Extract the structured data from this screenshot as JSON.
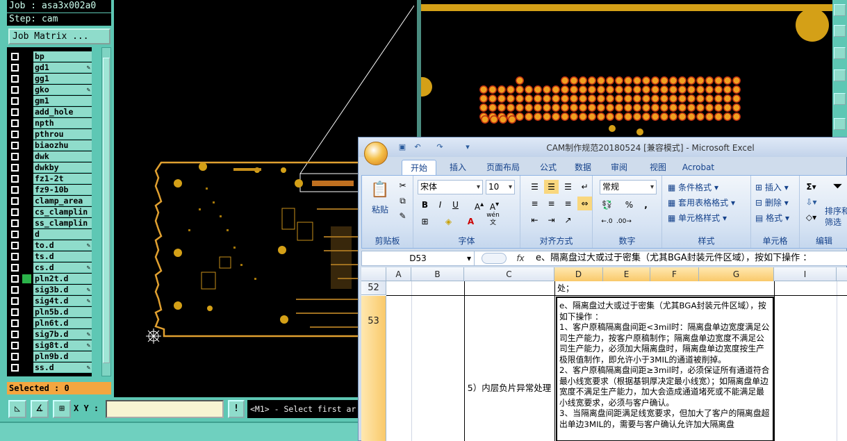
{
  "cam": {
    "job": "Job : asa3x002a0",
    "step": "Step: cam",
    "job_matrix": "Job Matrix ...",
    "selected": "Selected : 0",
    "xy_label": "X Y :",
    "xy_value": "",
    "message": "<M1> - Select first ar",
    "layers": [
      {
        "name": "bp",
        "active": false,
        "edit": false
      },
      {
        "name": "gd1",
        "active": false,
        "edit": true
      },
      {
        "name": "gg1",
        "active": false,
        "edit": false
      },
      {
        "name": "gko",
        "active": false,
        "edit": true
      },
      {
        "name": "gm1",
        "active": false,
        "edit": false
      },
      {
        "name": "add_hole",
        "active": false,
        "edit": false
      },
      {
        "name": "npth",
        "active": false,
        "edit": false
      },
      {
        "name": "pthrou",
        "active": false,
        "edit": false
      },
      {
        "name": "biaozhu",
        "active": false,
        "edit": false
      },
      {
        "name": "dwk",
        "active": false,
        "edit": false
      },
      {
        "name": "dwkby",
        "active": false,
        "edit": false
      },
      {
        "name": "fz1-2t",
        "active": false,
        "edit": false
      },
      {
        "name": "fz9-10b",
        "active": false,
        "edit": false
      },
      {
        "name": "clamp_area",
        "active": false,
        "edit": false
      },
      {
        "name": "cs_clamplin",
        "active": false,
        "edit": false
      },
      {
        "name": "ss_clamplin",
        "active": false,
        "edit": false
      },
      {
        "name": "d",
        "active": false,
        "edit": false
      },
      {
        "name": "to.d",
        "active": false,
        "edit": true
      },
      {
        "name": "ts.d",
        "active": false,
        "edit": false
      },
      {
        "name": "cs.d",
        "active": false,
        "edit": true
      },
      {
        "name": "pln2t.d",
        "active": true,
        "edit": false
      },
      {
        "name": "sig3b.d",
        "active": false,
        "edit": true
      },
      {
        "name": "sig4t.d",
        "active": false,
        "edit": true
      },
      {
        "name": "pln5b.d",
        "active": false,
        "edit": false
      },
      {
        "name": "pln6t.d",
        "active": false,
        "edit": false
      },
      {
        "name": "sig7b.d",
        "active": false,
        "edit": true
      },
      {
        "name": "sig8t.d",
        "active": false,
        "edit": true
      },
      {
        "name": "pln9b.d",
        "active": false,
        "edit": false
      },
      {
        "name": "ss.d",
        "active": false,
        "edit": true
      }
    ],
    "colors": {
      "panel": "#5ec7b4",
      "copper": "#d4a017",
      "outline": "#e0a030"
    }
  },
  "excel": {
    "title": "CAM制作规范20180524 [兼容模式] - Microsoft Excel",
    "tabs": [
      "开始",
      "插入",
      "页面布局",
      "公式",
      "数据",
      "审阅",
      "视图",
      "Acrobat"
    ],
    "active_tab": "开始",
    "clipboard": {
      "paste": "粘贴",
      "label": "剪贴板"
    },
    "font": {
      "name": "宋体",
      "size": "10",
      "label": "字体",
      "wen": "wén\n文"
    },
    "alignment": {
      "label": "对齐方式"
    },
    "number": {
      "format": "常规",
      "label": "数字",
      "percent": "%",
      "comma": ","
    },
    "styles": {
      "cond": "条件格式",
      "table": "套用表格格式",
      "cell": "单元格样式",
      "label": "样式"
    },
    "cells": {
      "insert": "插入",
      "delete": "删除",
      "format": "格式",
      "label": "单元格"
    },
    "edit": {
      "sort": "排序和",
      "filter": "筛选",
      "label": "编辑"
    },
    "name_box": "D53",
    "fx": "fx",
    "formula": "e、隔离盘过大或过于密集（尤其BGA封装元件区域），按如下操作 ：",
    "columns": [
      "A",
      "B",
      "C",
      "D",
      "E",
      "F",
      "G",
      "I"
    ],
    "rows": [
      {
        "num": "52",
        "d": "处；"
      },
      {
        "num": "53",
        "c": "5）内层负片异常处理",
        "d": "e、隔离盘过大或过于密集（尤其BGA封装元件区域），按如下操作 ：\n1、客户原稿隔离盘间距<3mil时：隔离盘单边宽度满足公司生产能力，按客户原稿制作；隔离盘单边宽度不满足公司生产能力，必须加大隔离盘时，隔离盘单边宽度按生产极限值制作，即允许小于3MIL的通道被削掉。\n2、客户原稿隔离盘间距≥3mil时，必须保证所有通道符合最小线宽要求（根据基铜厚决定最小线宽）；如隔离盘单边宽度不满足生产能力，加大会造成通道堵死或不能满足最小线宽要求，必须与客户确认。\n3、当隔离盘间距满足线宽要求，但加大了客户的隔离盘超出单边3MIL的，需要与客户确认允许加大隔离盘"
      }
    ]
  }
}
